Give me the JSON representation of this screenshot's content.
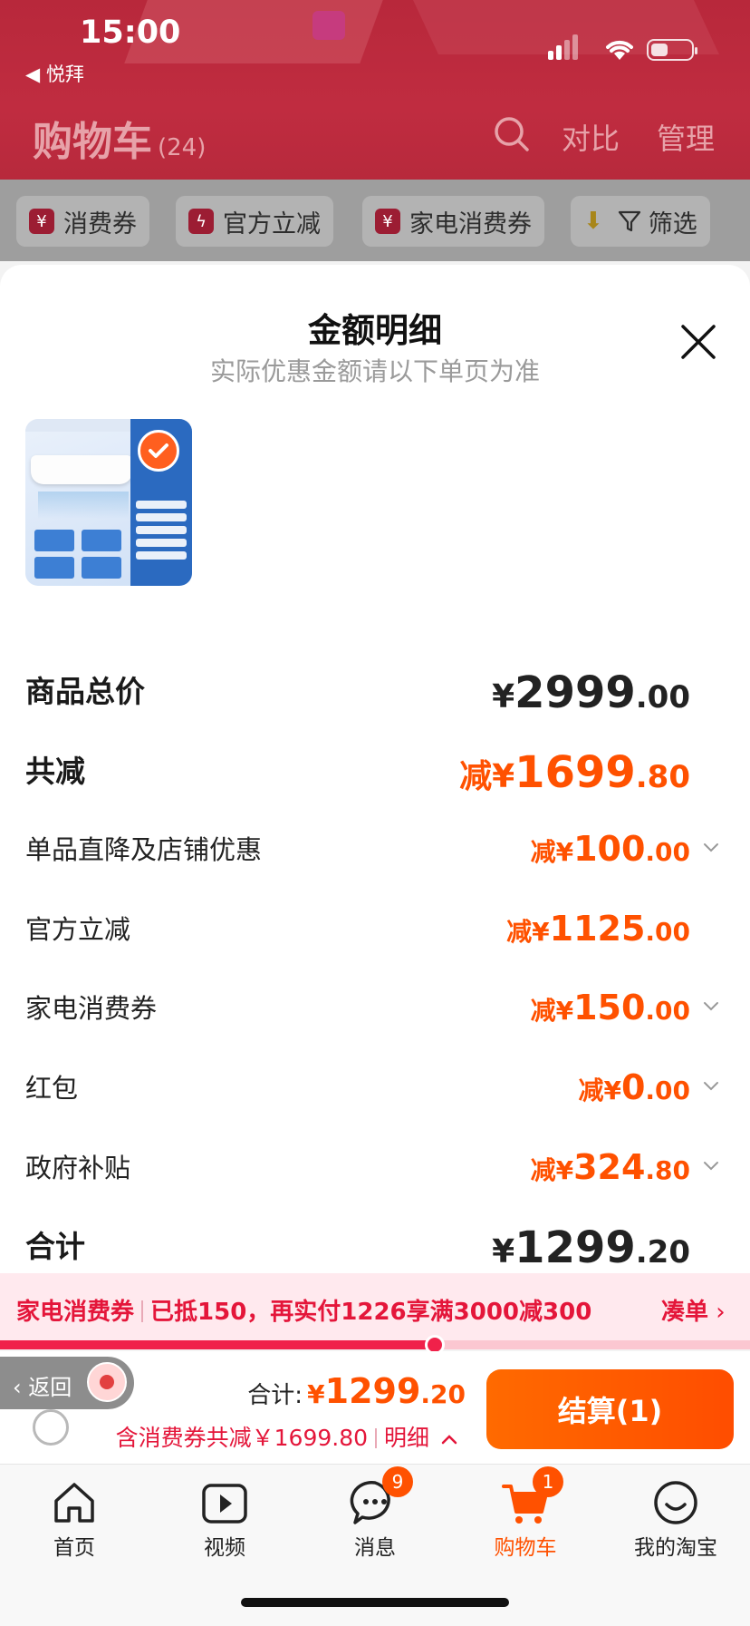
{
  "status_bar": {
    "time": "15:00",
    "back_app": "悦拜"
  },
  "header": {
    "title": "购物车",
    "count": "(24)",
    "compare": "对比",
    "manage": "管理"
  },
  "filters": [
    {
      "label": "消费券"
    },
    {
      "label": "官方立减"
    },
    {
      "label": "家电消费券"
    },
    {
      "label": "筛选"
    }
  ],
  "sheet": {
    "title": "金额明细",
    "subtitle": "实际优惠金额请以下单页为准",
    "rows": [
      {
        "label": "商品总价",
        "prefix": "¥",
        "int": "2999",
        "dec": ".00"
      },
      {
        "label": "共减",
        "prefix": "减¥",
        "int": "1699",
        "dec": ".80"
      },
      {
        "label": "单品直降及店铺优惠",
        "prefix": "减¥",
        "int": "100",
        "dec": ".00"
      },
      {
        "label": "官方立减",
        "prefix": "减¥",
        "int": "1125",
        "dec": ".00"
      },
      {
        "label": "家电消费券",
        "prefix": "减¥",
        "int": "150",
        "dec": ".00"
      },
      {
        "label": "红包",
        "prefix": "减¥",
        "int": "0",
        "dec": ".00"
      },
      {
        "label": "政府补贴",
        "prefix": "减¥",
        "int": "324",
        "dec": ".80"
      },
      {
        "label": "合计",
        "prefix": "¥",
        "int": "1299",
        "dec": ".20"
      }
    ]
  },
  "coupon_banner": {
    "name": "家电消费券",
    "message": "已抵150，再实付1226享满3000减300",
    "action": "凑单",
    "progress": 0.58
  },
  "checkout": {
    "back_label": "返回",
    "total_label": "合计:",
    "total_prefix": "¥",
    "total_int": "1299",
    "total_dec": ".20",
    "discount_text": "含消费券共减￥1699.80",
    "detail_label": "明细",
    "button_label": "结算(1)"
  },
  "tabbar": [
    {
      "label": "首页"
    },
    {
      "label": "视频"
    },
    {
      "label": "消息",
      "badge": "9"
    },
    {
      "label": "购物车",
      "badge": "1"
    },
    {
      "label": "我的淘宝"
    }
  ],
  "colors": {
    "accent": "#ff5100",
    "coupon_red": "#e4163a",
    "header_red": "#c02c40"
  }
}
